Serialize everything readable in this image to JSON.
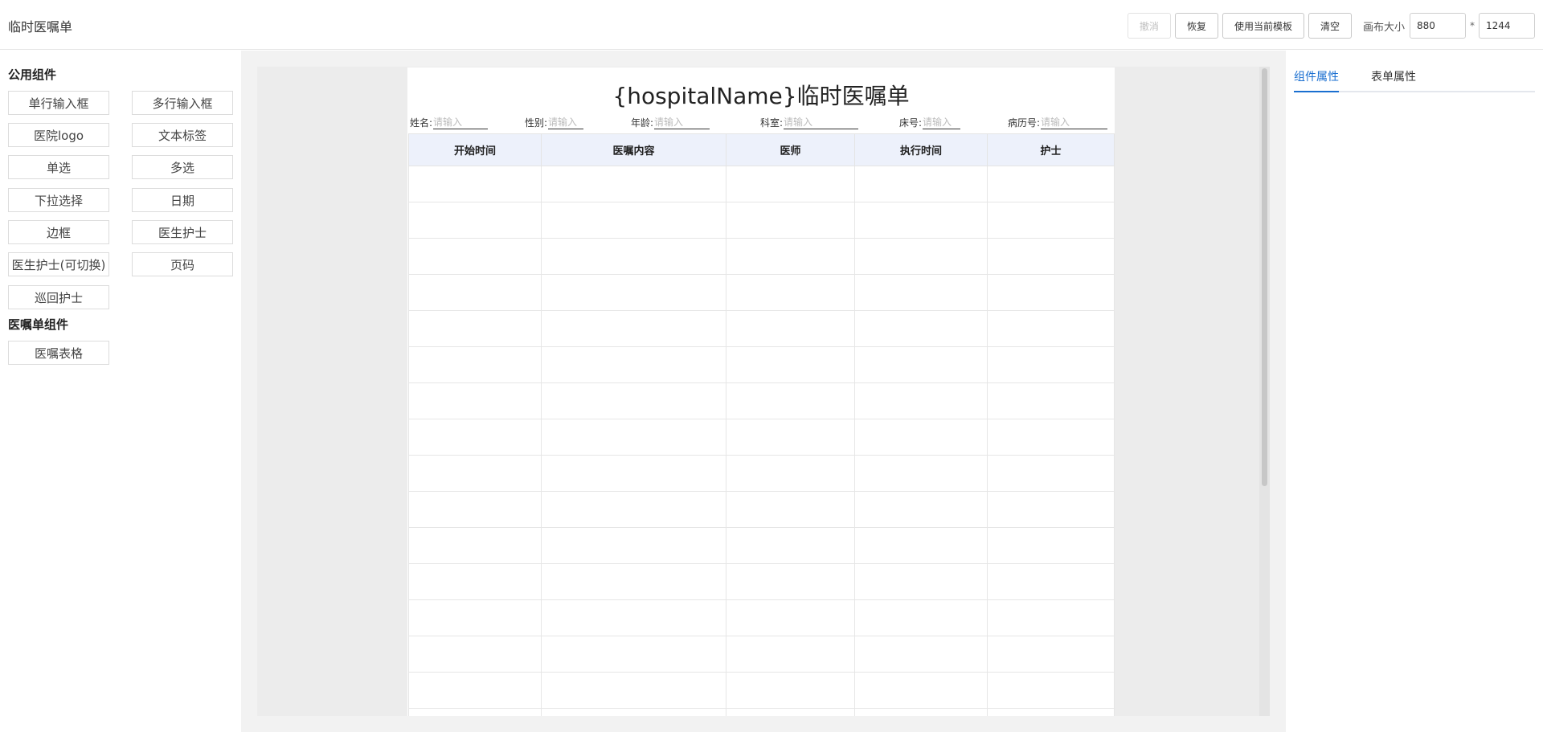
{
  "header": {
    "title": "临时医嘱单",
    "toolbar": {
      "undo": "撤消",
      "redo": "恢复",
      "use_template": "使用当前模板",
      "clear": "清空",
      "canvas_size_label": "画布大小",
      "width_value": "880",
      "separator": "*",
      "height_value": "1244"
    }
  },
  "left_panel": {
    "common_title": "公用组件",
    "common_components": [
      "单行输入框",
      "多行输入框",
      "医院logo",
      "文本标签",
      "单选",
      "多选",
      "下拉选择",
      "日期",
      "边框",
      "医生护士",
      "医生护士(可切换)",
      "页码",
      "巡回护士"
    ],
    "order_title": "医嘱单组件",
    "order_components": [
      "医嘱表格"
    ]
  },
  "canvas": {
    "doc_title": "{hospitalName}临时医嘱单",
    "fields": [
      {
        "label": "姓名:",
        "placeholder": "请输入"
      },
      {
        "label": "性别:",
        "placeholder": "请输入"
      },
      {
        "label": "年龄:",
        "placeholder": "请输入"
      },
      {
        "label": "科室:",
        "placeholder": "请输入"
      },
      {
        "label": "床号:",
        "placeholder": "请输入"
      },
      {
        "label": "病历号:",
        "placeholder": "请输入"
      }
    ],
    "table_headers": [
      "开始时间",
      "医嘱内容",
      "医师",
      "执行时间",
      "护士"
    ]
  },
  "right_panel": {
    "tabs": [
      "组件属性",
      "表单属性"
    ],
    "active_tab": "组件属性"
  },
  "colors": {
    "accent": "#1a6fd0",
    "table_header_bg": "#edf1fb",
    "canvas_bg": "#ececec"
  }
}
